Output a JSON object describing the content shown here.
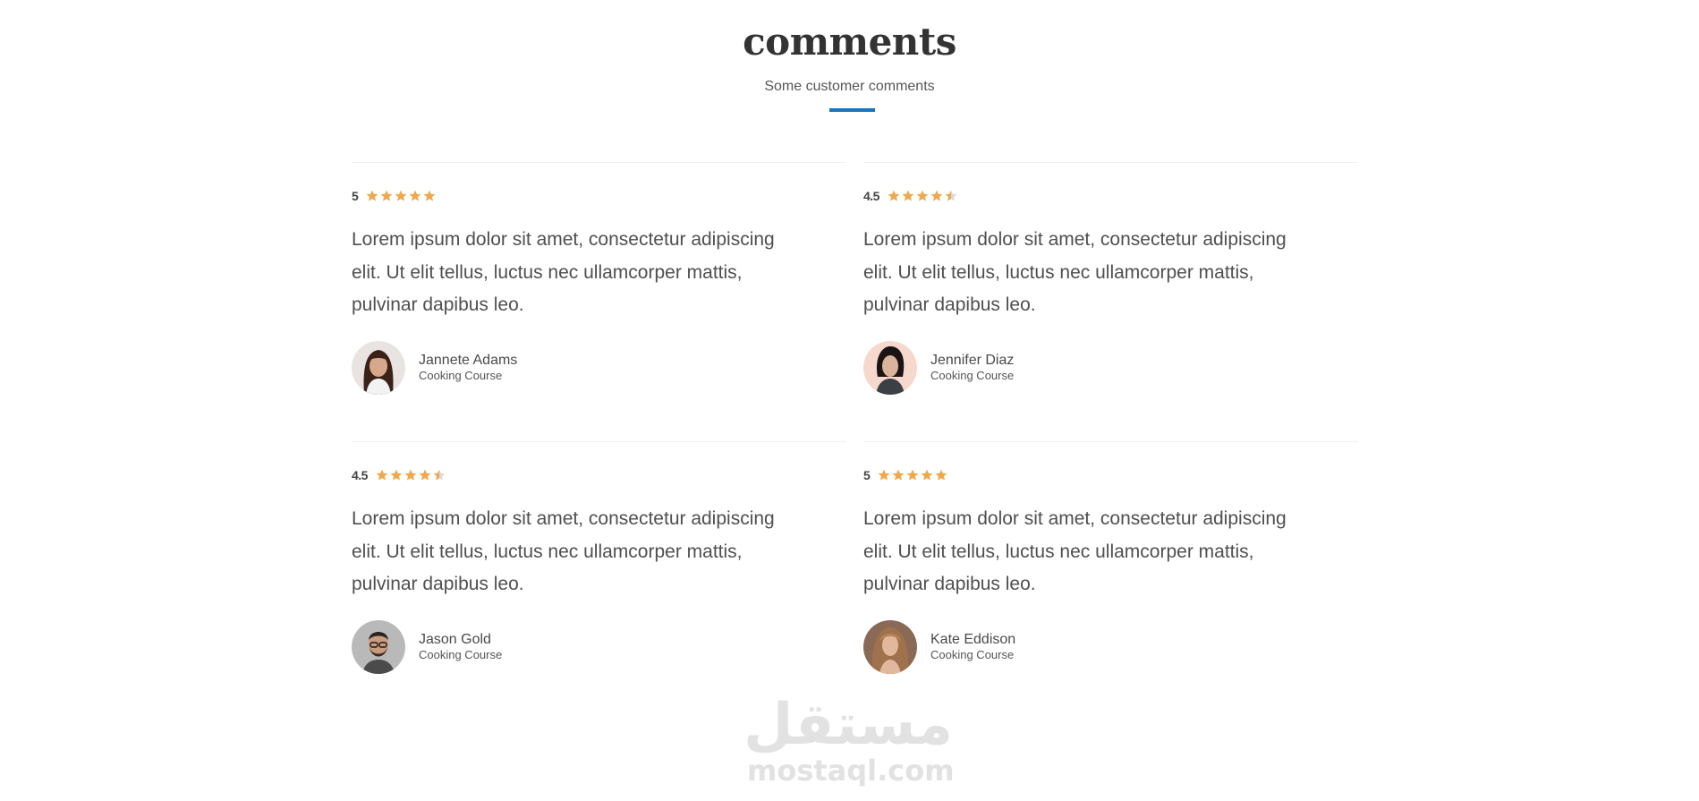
{
  "section": {
    "title": "comments",
    "subtitle": "Some customer comments",
    "accent_color": "#1276c4",
    "star_color": "#f0a84a"
  },
  "comments": [
    {
      "rating": "5",
      "stars_value": 5,
      "text": "Lorem ipsum dolor sit amet, consectetur adipiscing elit. Ut elit tellus, luctus nec ullamcorper mattis, pulvinar dapibus leo.",
      "name": "Jannete Adams",
      "course": "Cooking Course",
      "avatar": "woman-portrait-avatar"
    },
    {
      "rating": "4.5",
      "stars_value": 4.5,
      "text": "Lorem ipsum dolor sit amet, consectetur adipiscing elit. Ut elit tellus, luctus nec ullamcorper mattis, pulvinar dapibus leo.",
      "name": "Jennifer Diaz",
      "course": "Cooking Course",
      "avatar": "woman-portrait-avatar"
    },
    {
      "rating": "4.5",
      "stars_value": 4.5,
      "text": "Lorem ipsum dolor sit amet, consectetur adipiscing elit. Ut elit tellus, luctus nec ullamcorper mattis, pulvinar dapibus leo.",
      "name": "Jason Gold",
      "course": "Cooking Course",
      "avatar": "man-portrait-avatar"
    },
    {
      "rating": "5",
      "stars_value": 5,
      "text": "Lorem ipsum dolor sit amet, consectetur adipiscing elit. Ut elit tellus, luctus nec ullamcorper mattis, pulvinar dapibus leo.",
      "name": "Kate Eddison",
      "course": "Cooking Course",
      "avatar": "woman-portrait-avatar"
    }
  ],
  "watermark": {
    "arabic": "مستقل",
    "latin": "mostaql.com"
  }
}
